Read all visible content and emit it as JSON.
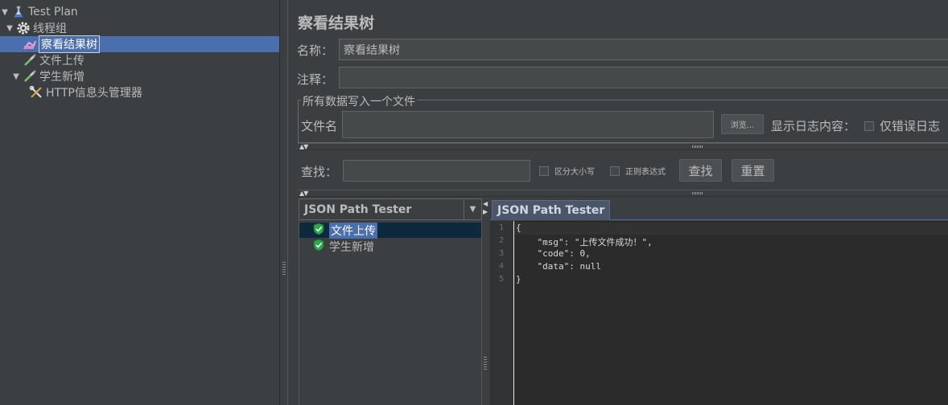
{
  "tree": {
    "items": [
      {
        "label": "Test Plan",
        "icon": "flask-icon",
        "expander": "▼"
      },
      {
        "label": "线程组",
        "icon": "gear-icon",
        "expander": "▼"
      },
      {
        "label": "察看结果树",
        "icon": "result-tree-icon",
        "expander": ""
      },
      {
        "label": "文件上传",
        "icon": "pipette-icon",
        "expander": ""
      },
      {
        "label": "学生新增",
        "icon": "pipette-icon",
        "expander": "▼"
      },
      {
        "label": "HTTP信息头管理器",
        "icon": "tools-icon",
        "expander": ""
      }
    ]
  },
  "panel": {
    "title": "察看结果树",
    "name_label": "名称：",
    "name_value": "察看结果树",
    "comment_label": "注释：",
    "comment_value": "",
    "file_group_title": "所有数据写入一个文件",
    "filename_label": "文件名",
    "filename_value": "",
    "browse_label": "浏览...",
    "log_display_label": "显示日志内容：",
    "errors_only_label": "仅错误日志"
  },
  "search": {
    "label": "查找：",
    "value": "",
    "case_sensitive_label": "区分大小写",
    "regex_label": "正则表达式",
    "find_button": "查找",
    "reset_button": "重置"
  },
  "renderer": {
    "selected": "JSON Path Tester"
  },
  "results": [
    {
      "label": "文件上传",
      "status": "success"
    },
    {
      "label": "学生新增",
      "status": "success"
    }
  ],
  "tabs": [
    {
      "label": "JSON Path Tester",
      "active": true
    }
  ],
  "editor": {
    "line_numbers": [
      "1",
      "2",
      "3",
      "4",
      "5"
    ],
    "lines": [
      "{",
      "    \"msg\": \"上传文件成功！\",",
      "    \"code\": 0,",
      "    \"data\": null",
      "}"
    ]
  },
  "colors": {
    "background": "#3c3f41",
    "selection": "#4b6eaf",
    "success_shield": "#2ea84a"
  }
}
